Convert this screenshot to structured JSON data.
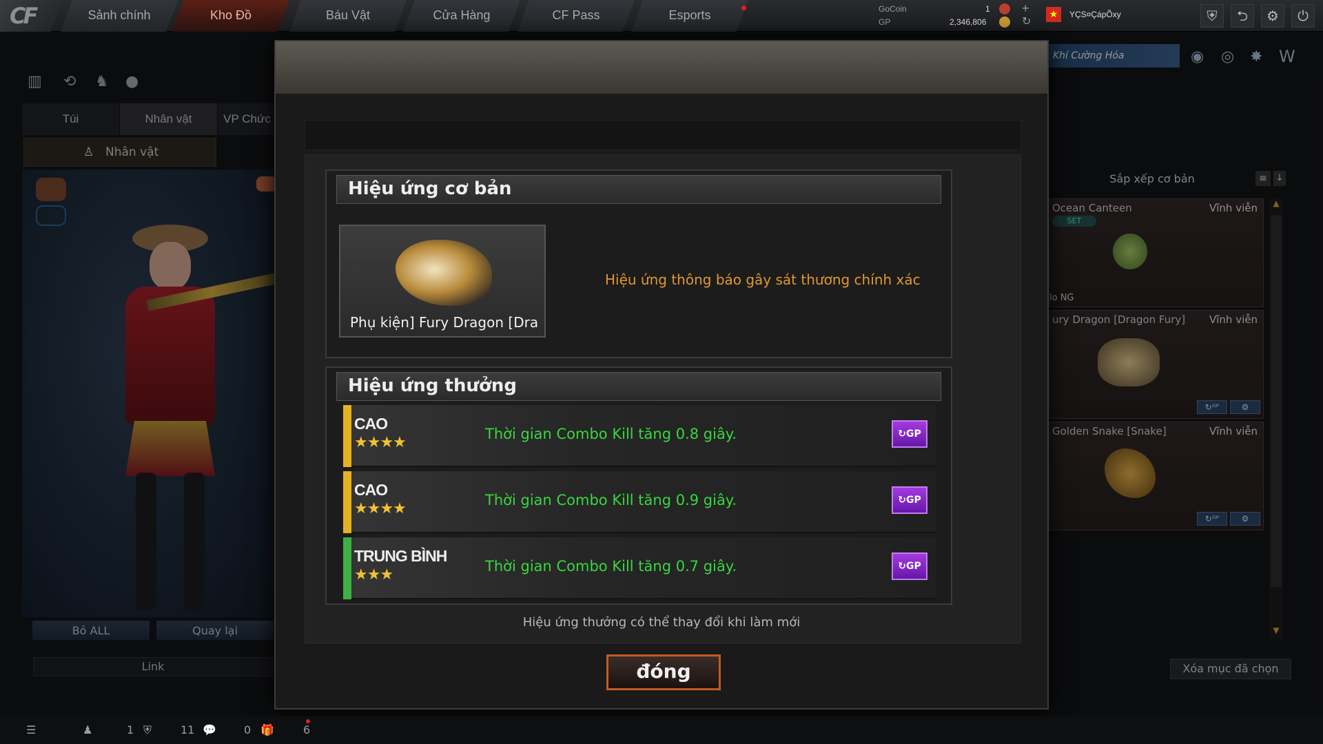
{
  "topbar": {
    "logo": "CF",
    "tabs": [
      "Sảnh chính",
      "Kho Đồ",
      "Báu Vật",
      "Cửa Hàng",
      "CF Pass",
      "Esports"
    ],
    "active_tab": "Kho Đồ",
    "currency": {
      "gocoin_label": "GoCoin",
      "gocoin_value": "1",
      "gp_label": "GP",
      "gp_value": "2,346,806"
    },
    "username": "YÇS¤ÇápÕxy",
    "icons": [
      "shield-icon",
      "refresh-icon",
      "gear-icon",
      "power-icon"
    ]
  },
  "left_panel": {
    "icons": [
      "ranking-icon",
      "history-icon",
      "character-icon",
      "grenade-icon"
    ],
    "tabs": [
      "Túi",
      "Nhân vật",
      "VP Chức"
    ],
    "active_tab": "Nhân vật",
    "subtab": "Nhân vật",
    "buttons": {
      "remove_all": "Bỏ ALL",
      "back": "Quay lại",
      "link": "Link"
    }
  },
  "right_panel": {
    "banner": "Khí Cường Hóa",
    "sort_label": "Sắp xếp cơ bản",
    "items": [
      {
        "name": "Ocean Canteen",
        "duration": "Vĩnh viễn",
        "tag": "SET",
        "sub": "lo NG"
      },
      {
        "name": "ury Dragon [Dragon Fury]",
        "duration": "Vĩnh viễn"
      },
      {
        "name": "Golden Snake [Snake]",
        "duration": "Vĩnh viễn"
      }
    ],
    "clear_selected": "Xóa mục đã chọn"
  },
  "modal": {
    "basic_section": {
      "title": "Hiệu ứng cơ bản",
      "item_name": "Phụ kiện] Fury Dragon [Dra",
      "effect": "Hiệu ứng thông báo gây sát thương chính xác"
    },
    "bonus_section": {
      "title": "Hiệu ứng thưởng",
      "rows": [
        {
          "grade": "CAO",
          "stars": "★★★★",
          "effect": "Thời gian Combo Kill tăng 0.8 giây.",
          "bar_color": "#e5b321"
        },
        {
          "grade": "CAO",
          "stars": "★★★★",
          "effect": "Thời gian Combo Kill tăng 0.9 giây.",
          "bar_color": "#e5b321"
        },
        {
          "grade": "TRUNG BÌNH",
          "stars": "★★★",
          "effect": "Thời gian Combo Kill tăng 0.7 giây.",
          "bar_color": "#3fb044"
        }
      ],
      "reroll_label": "GP"
    },
    "note": "Hiệu ứng thưởng có thể thay đổi khi làm mới",
    "close_button": "đóng"
  },
  "bottombar": {
    "counts": [
      "1",
      "11",
      "0",
      "6"
    ]
  }
}
